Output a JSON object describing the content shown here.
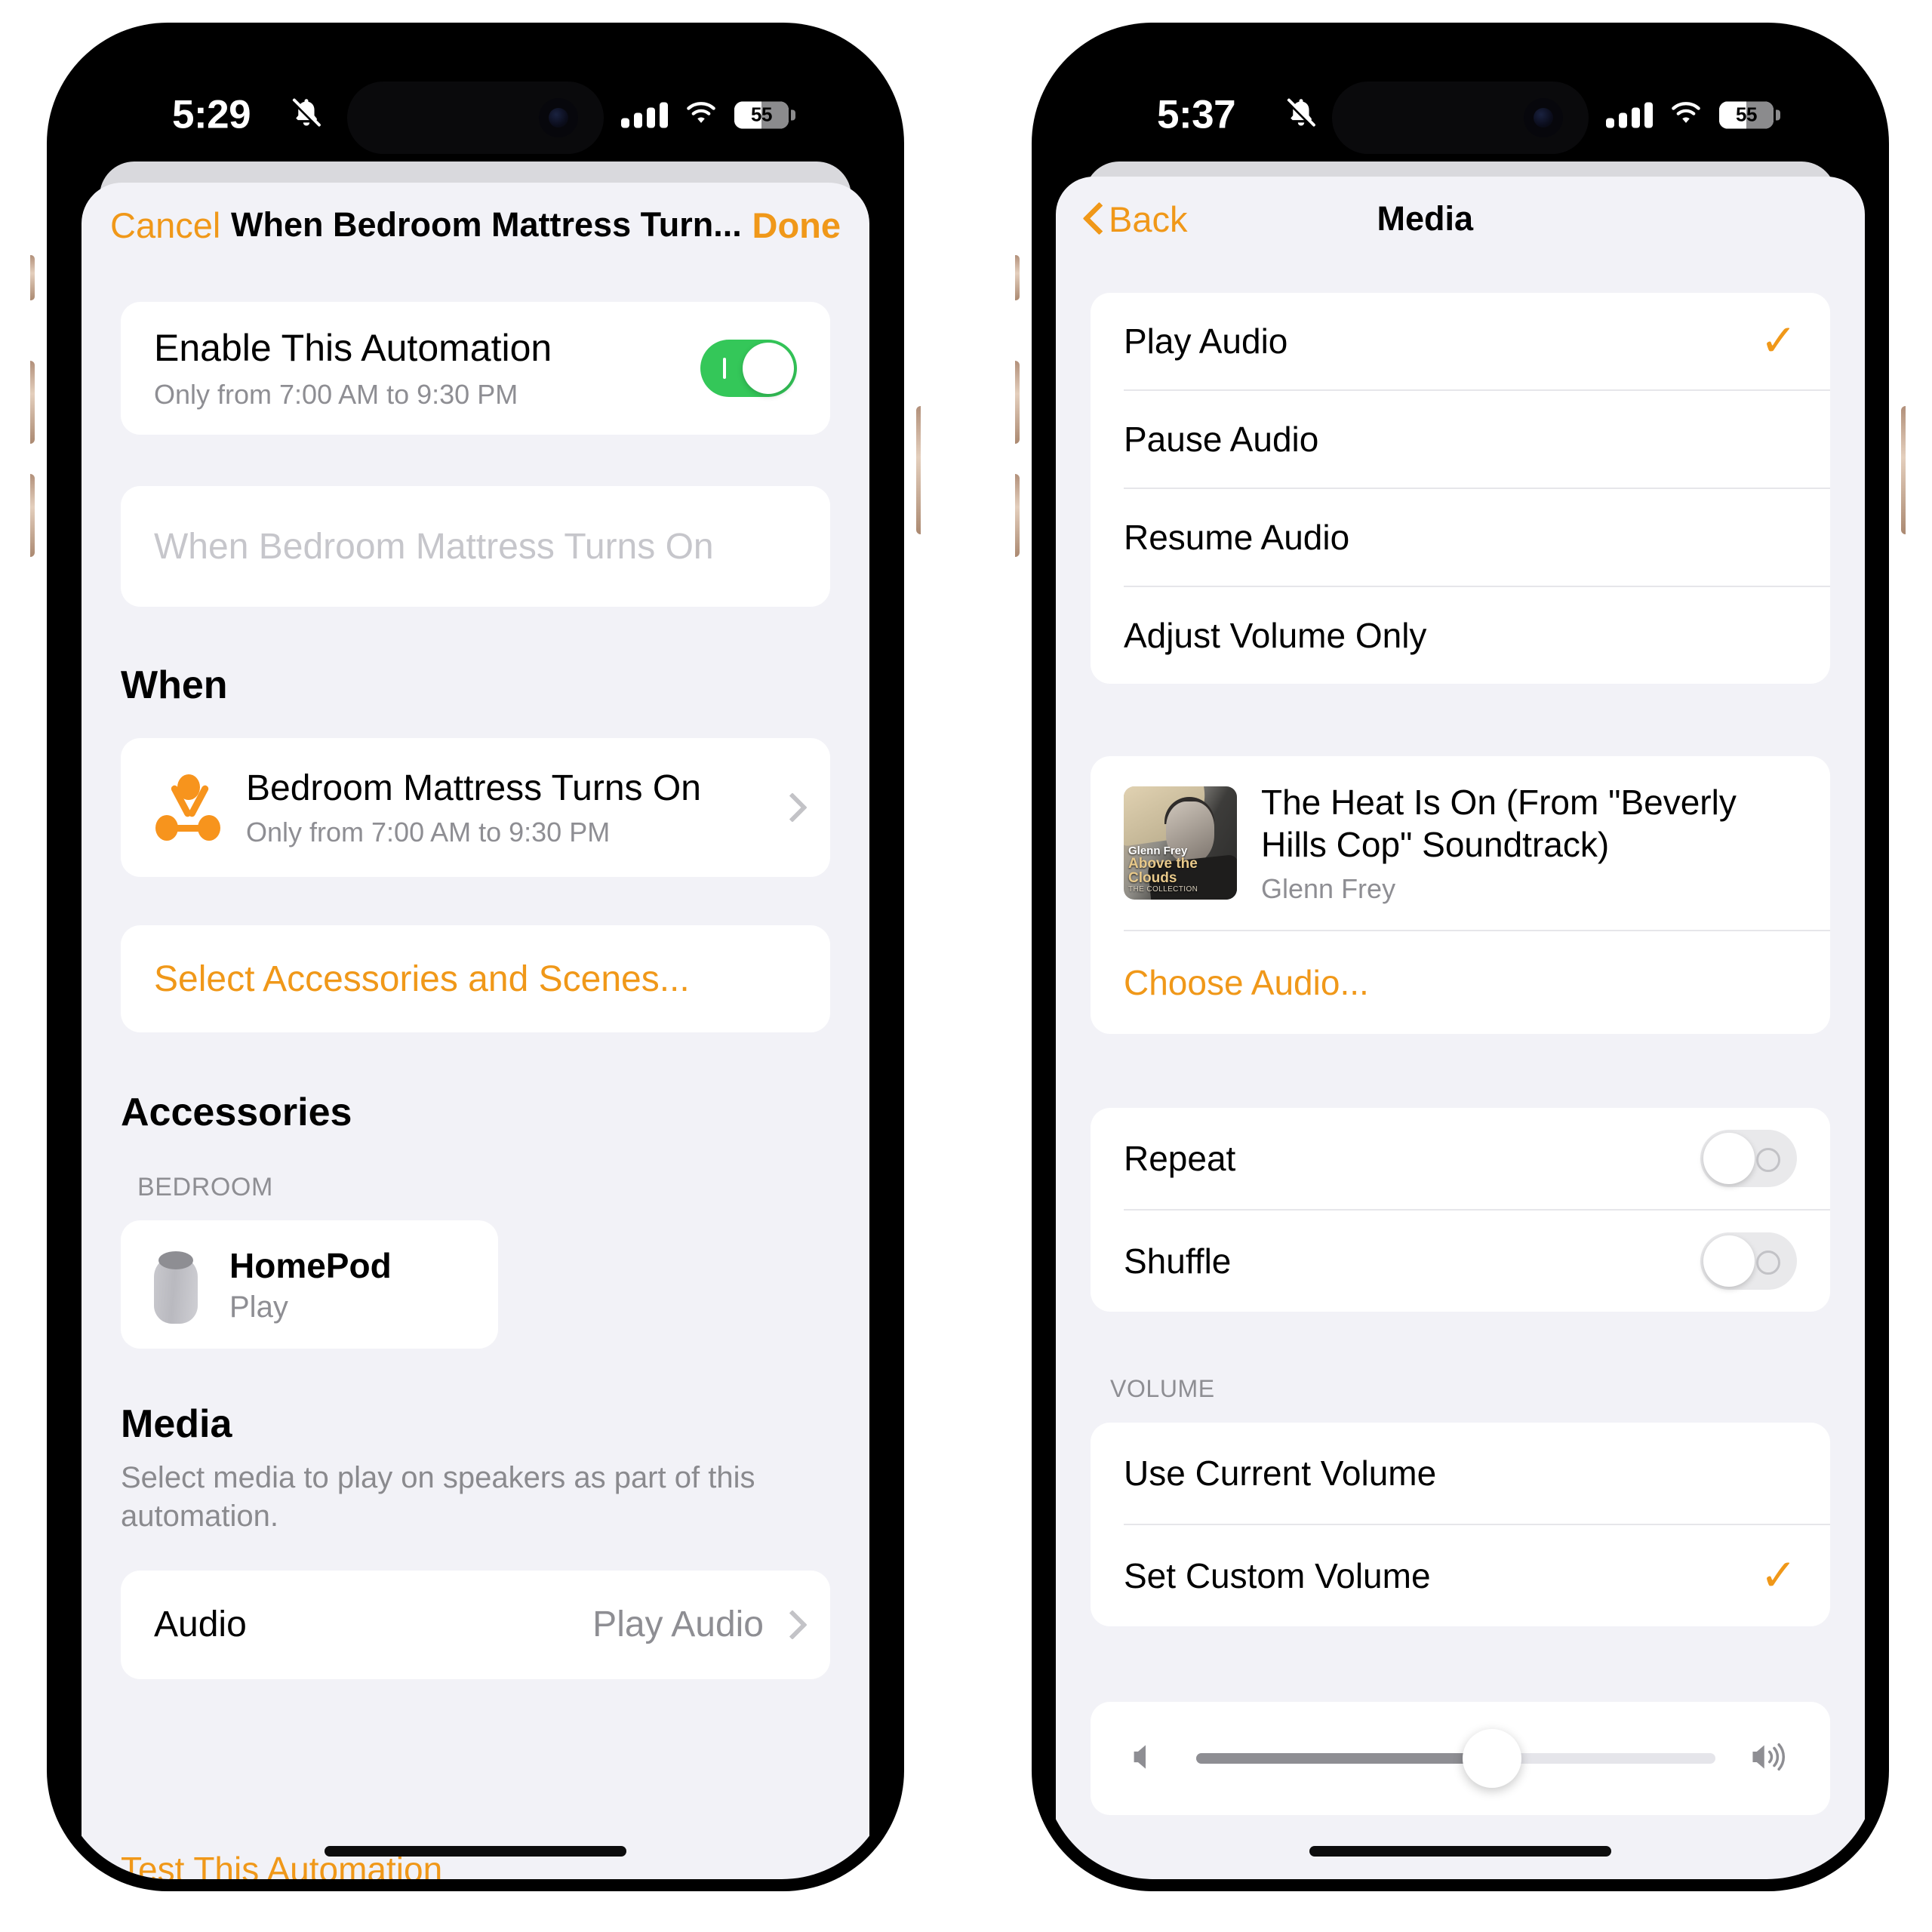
{
  "phone_left": {
    "status_bar": {
      "time": "5:29",
      "silent_icon": "bell-slash-icon",
      "battery_percent": "55",
      "wifi": "wifi-icon",
      "cellular": "cellular-icon"
    },
    "nav": {
      "cancel_label": "Cancel",
      "title": "When Bedroom Mattress Turn...",
      "done_label": "Done"
    },
    "enable_card": {
      "title": "Enable This Automation",
      "subtitle": "Only from 7:00 AM to 9:30 PM",
      "toggle_state": "on"
    },
    "name_field": {
      "placeholder": "When Bedroom Mattress Turns On",
      "value": ""
    },
    "when_section": {
      "heading": "When",
      "trigger_title": "Bedroom Mattress Turns On",
      "trigger_subtitle": "Only from 7:00 AM to 9:30 PM",
      "select_link": "Select Accessories and Scenes..."
    },
    "accessories_section": {
      "heading": "Accessories",
      "group_label": "BEDROOM",
      "item_title": "HomePod",
      "item_state": "Play"
    },
    "media_section": {
      "heading": "Media",
      "description": "Select media to play on speakers as part of this automation.",
      "audio_row_label": "Audio",
      "audio_row_value": "Play Audio"
    },
    "footer_cut_text": "Test This Automation"
  },
  "phone_right": {
    "status_bar": {
      "time": "5:37",
      "silent_icon": "bell-slash-icon",
      "battery_percent": "55",
      "wifi": "wifi-icon",
      "cellular": "cellular-icon"
    },
    "nav": {
      "back_label": "Back",
      "title": "Media"
    },
    "mode_options": [
      {
        "label": "Play Audio",
        "selected": true
      },
      {
        "label": "Pause Audio",
        "selected": false
      },
      {
        "label": "Resume Audio",
        "selected": false
      },
      {
        "label": "Adjust Volume Only",
        "selected": false
      }
    ],
    "track": {
      "title": "The Heat Is On (From \"Beverly Hills Cop\" Soundtrack)",
      "artist": "Glenn Frey",
      "artwork_line1": "Glenn Frey",
      "artwork_line2": "Above the",
      "artwork_line3": "Clouds",
      "artwork_line4": "THE COLLECTION",
      "choose_link": "Choose Audio..."
    },
    "playback_toggles": [
      {
        "label": "Repeat",
        "state": "off"
      },
      {
        "label": "Shuffle",
        "state": "off"
      }
    ],
    "volume_section": {
      "group_label": "VOLUME",
      "options": [
        {
          "label": "Use Current Volume",
          "selected": false
        },
        {
          "label": "Set Custom Volume",
          "selected": true
        }
      ],
      "slider_percent": 57,
      "min_icon": "speaker-low-icon",
      "max_icon": "speaker-high-icon"
    }
  },
  "colors": {
    "accent": "#f09819",
    "toggle_on": "#34c759",
    "background": "#f2f2f7",
    "card": "#ffffff",
    "secondary_text": "#8e8e93"
  }
}
